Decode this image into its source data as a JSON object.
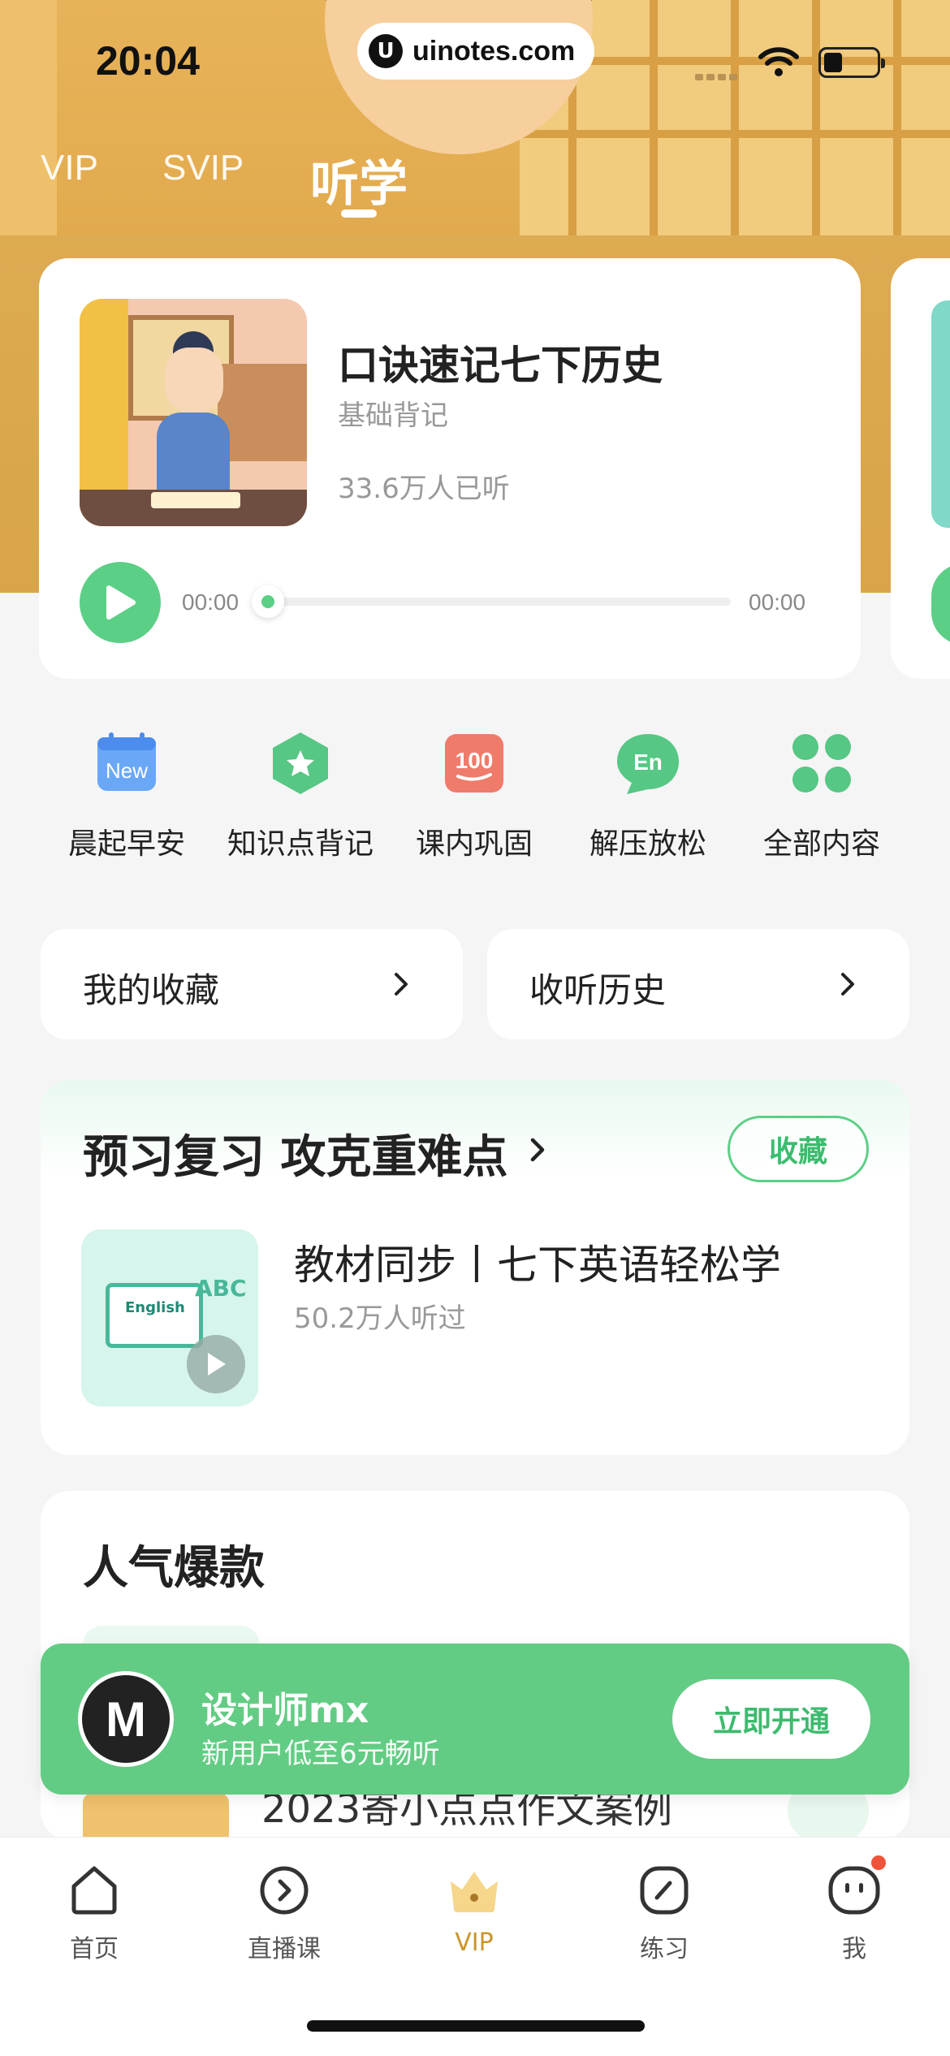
{
  "status_bar": {
    "time": "20:04",
    "url": "uinotes.com"
  },
  "top_tabs": [
    {
      "label": "VIP"
    },
    {
      "label": "SVIP"
    },
    {
      "label": "听学",
      "active": true
    }
  ],
  "player": {
    "title": "口诀速记七下历史",
    "subtitle": "基础背记",
    "listeners": "33.6万人已听",
    "time_current": "00:00",
    "time_total": "00:00",
    "progress": 0
  },
  "categories": [
    {
      "label": "晨起早安",
      "icon": "new-calendar-icon",
      "badge": "New"
    },
    {
      "label": "知识点背记",
      "icon": "star-hexagon-icon"
    },
    {
      "label": "课内巩固",
      "icon": "score-100-icon",
      "badge": "100"
    },
    {
      "label": "解压放松",
      "icon": "english-bubble-icon",
      "badge": "En"
    },
    {
      "label": "全部内容",
      "icon": "grid-icon"
    }
  ],
  "quick_links": {
    "favorites": "我的收藏",
    "history": "收听历史"
  },
  "preview_section": {
    "heading": "预习复习 攻克重难点",
    "collect_label": "收藏",
    "course": {
      "title": "教材同步丨七下英语轻松学",
      "listeners": "50.2万人听过",
      "thumb_word": "English",
      "thumb_letters": "ABC"
    }
  },
  "popular_section": {
    "heading": "人气爆款",
    "partial_item": "2023寄小点点作文案例"
  },
  "vip_banner": {
    "avatar_letter": "M",
    "name": "设计师mx",
    "description": "新用户低至6元畅听",
    "button": "立即开通"
  },
  "bottom_nav": [
    {
      "label": "首页",
      "icon": "home-icon"
    },
    {
      "label": "直播课",
      "icon": "live-play-icon"
    },
    {
      "label": "VIP",
      "icon": "crown-icon",
      "active": true
    },
    {
      "label": "练习",
      "icon": "pencil-icon"
    },
    {
      "label": "我",
      "icon": "face-icon",
      "has_dot": true
    }
  ],
  "colors": {
    "accent_green": "#5ccf86",
    "header_gold": "#e2aa4d",
    "vip_gold": "#c9962e",
    "notification_red": "#f0523a"
  }
}
